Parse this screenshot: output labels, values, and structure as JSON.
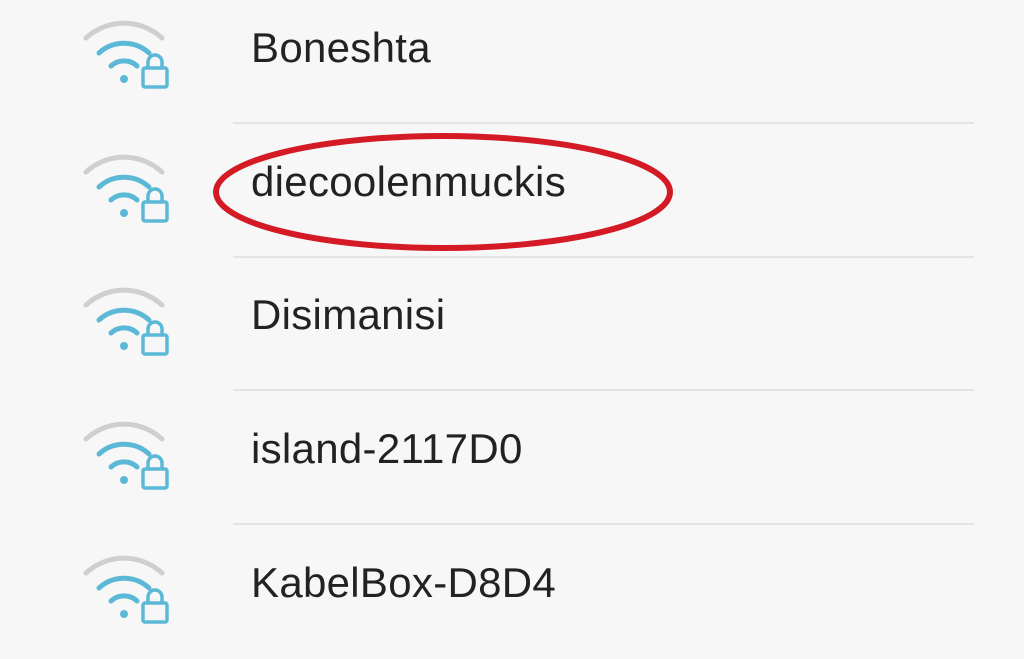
{
  "colors": {
    "background": "#f7f7f7",
    "text": "#222222",
    "wifi_active": "#5bb8d6",
    "wifi_inactive": "#cfcfcf",
    "divider": "#e4e4e4",
    "highlight": "#d41a24"
  },
  "networks": [
    {
      "ssid": "Boneshta",
      "icon": "wifi-locked-icon"
    },
    {
      "ssid": "diecoolenmuckis",
      "icon": "wifi-locked-icon",
      "highlighted": true
    },
    {
      "ssid": "Disimanisi",
      "icon": "wifi-locked-icon"
    },
    {
      "ssid": "island-2117D0",
      "icon": "wifi-locked-icon"
    },
    {
      "ssid": "KabelBox-D8D4",
      "icon": "wifi-locked-icon"
    }
  ]
}
